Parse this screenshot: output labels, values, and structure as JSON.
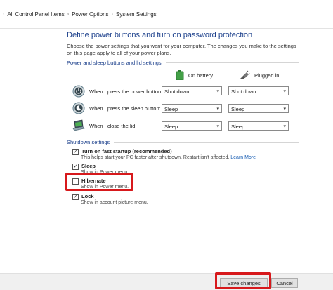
{
  "breadcrumb": [
    "All Control Panel Items",
    "Power Options",
    "System Settings"
  ],
  "title": "Define power buttons and turn on password protection",
  "description": "Choose the power settings that you want for your computer. The changes you make to the settings on this page apply to all of your power plans.",
  "buttons_section": {
    "header": "Power and sleep buttons and lid settings",
    "col_battery": "On battery",
    "col_plugged": "Plugged in",
    "rows": [
      {
        "label": "When I press the power button:",
        "battery": "Shut down",
        "plugged": "Shut down"
      },
      {
        "label": "When I press the sleep button:",
        "battery": "Sleep",
        "plugged": "Sleep"
      },
      {
        "label": "When I close the lid:",
        "battery": "Sleep",
        "plugged": "Sleep"
      }
    ]
  },
  "shutdown_section": {
    "header": "Shutdown settings",
    "items": [
      {
        "label": "Turn on fast startup (recommended)",
        "checked": true,
        "sub": "This helps start your PC faster after shutdown. Restart isn't affected.",
        "link": "Learn More"
      },
      {
        "label": "Sleep",
        "checked": true,
        "sub": "Show in Power menu."
      },
      {
        "label": "Hibernate",
        "checked": false,
        "sub": "Show in Power menu."
      },
      {
        "label": "Lock",
        "checked": true,
        "sub": "Show in account picture menu."
      }
    ]
  },
  "footer": {
    "save": "Save changes",
    "cancel": "Cancel"
  },
  "colors": {
    "accent": "#1b3f8b",
    "highlight": "#d7191c",
    "link": "#1a5fb4"
  },
  "icons": [
    "battery-icon",
    "plug-icon",
    "power-button-icon",
    "sleep-button-icon",
    "laptop-lid-icon",
    "chevron-right-icon",
    "chevron-down-icon",
    "checkmark-icon"
  ]
}
